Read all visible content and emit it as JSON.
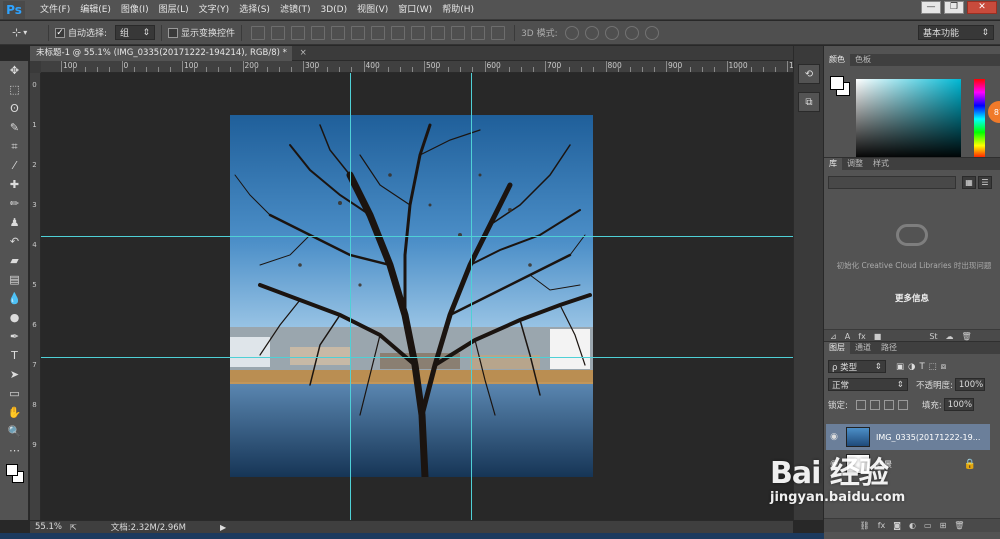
{
  "app": {
    "logo": "Ps",
    "menu": [
      "文件(F)",
      "编辑(E)",
      "图像(I)",
      "图层(L)",
      "文字(Y)",
      "选择(S)",
      "滤镜(T)",
      "3D(D)",
      "视图(V)",
      "窗口(W)",
      "帮助(H)"
    ],
    "window_controls": {
      "minimize": "—",
      "restore": "❐",
      "close": "✕"
    }
  },
  "options": {
    "auto_select_label": "自动选择:",
    "auto_select_checked": "✓",
    "auto_select_value": "组",
    "show_transform_label": "显示变换控件",
    "mode_3d_label": "3D 模式:",
    "workspace": "基本功能"
  },
  "document": {
    "tab_title": "未标题-1 @ 55.1% (IMG_0335(20171222-194214), RGB/8) *",
    "close": "×"
  },
  "rulers": {
    "h_labels": [
      "100",
      "0",
      "100",
      "200",
      "300",
      "400",
      "500",
      "600",
      "700",
      "800",
      "900",
      "1000",
      "1100",
      "1200",
      "1300"
    ],
    "v_labels": [
      "0",
      "1",
      "2",
      "3",
      "4",
      "5",
      "6",
      "7",
      "8",
      "9"
    ]
  },
  "status": {
    "zoom": "55.1%",
    "doc_info": "文档:2.32M/2.96M",
    "arrow": "▶"
  },
  "color_panel": {
    "tabs": [
      "颜色",
      "色板"
    ],
    "badge": "87"
  },
  "library_panel": {
    "tabs": [
      "库",
      "调整",
      "样式"
    ],
    "message": "初始化 Creative Cloud Libraries 时出现问题",
    "more_info": "更多信息"
  },
  "layers_panel": {
    "tabs": [
      "图层",
      "通道",
      "路径"
    ],
    "filter_kind": "ρ 类型",
    "blend_mode": "正常",
    "opacity_label": "不透明度:",
    "opacity_value": "100%",
    "lock_label": "锁定:",
    "fill_label": "填充:",
    "fill_value": "100%",
    "layers": [
      {
        "name": "IMG_0335(20171222-19...",
        "selected": true
      },
      {
        "name": "背景",
        "selected": false
      }
    ],
    "footer_icons": [
      "link-icon",
      "fx",
      "mask-icon",
      "adjustment-icon",
      "folder-icon",
      "new-layer-icon",
      "trash-icon"
    ]
  },
  "watermark": {
    "brand": "Bai 经验",
    "url": "jingyan.baidu.com"
  }
}
